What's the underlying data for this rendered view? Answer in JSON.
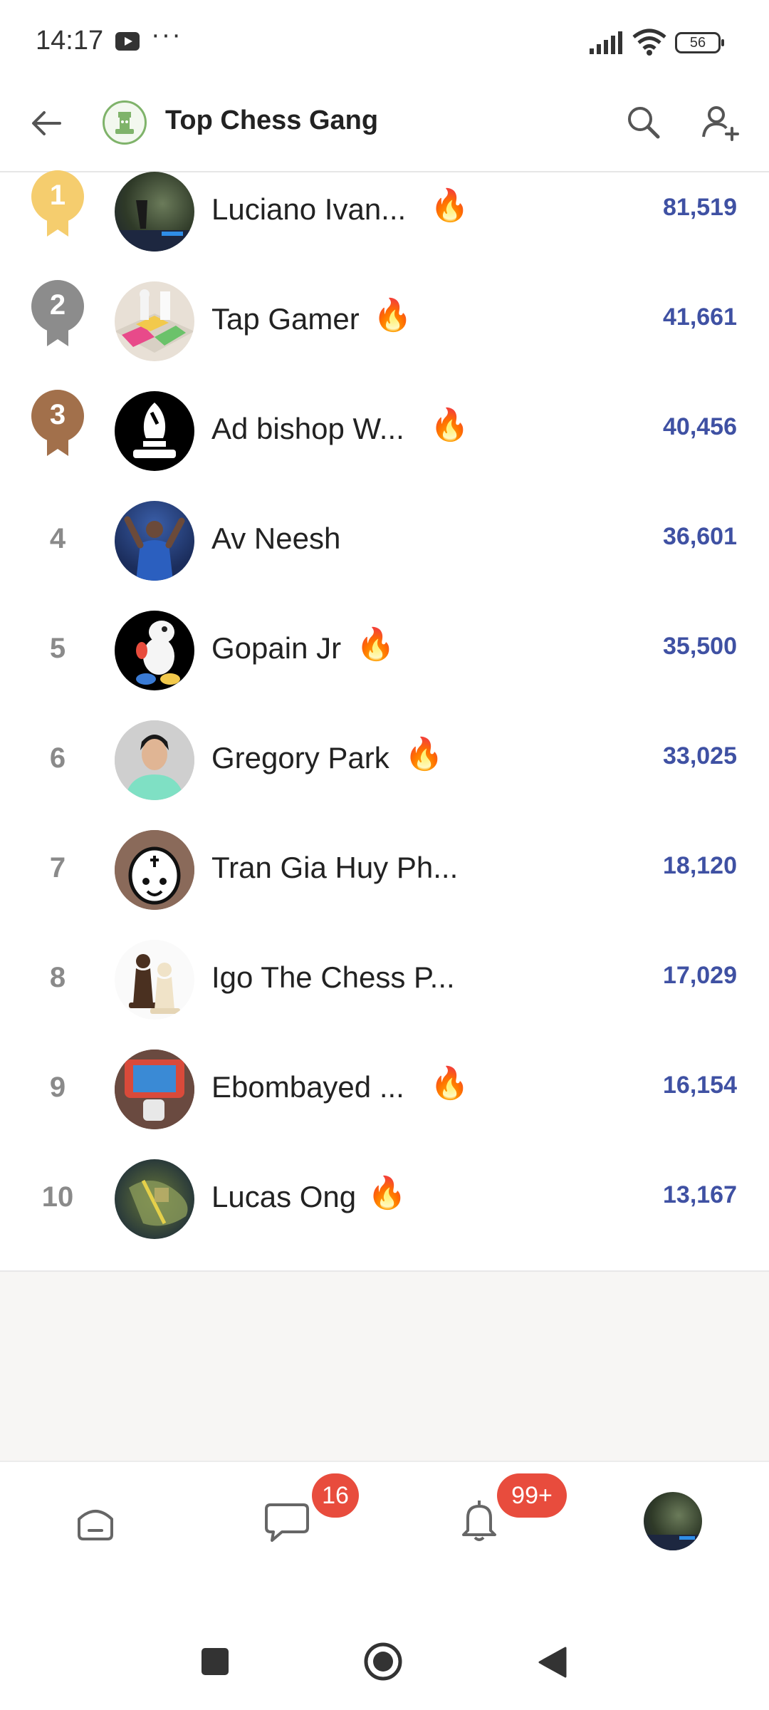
{
  "status_bar": {
    "time": "14:17",
    "battery": "56"
  },
  "header": {
    "title": "Top Chess Gang"
  },
  "leaderboard": [
    {
      "rank": "1",
      "name": "Luciano Ivan...",
      "score": "81,519",
      "fire": true,
      "medal": "gold"
    },
    {
      "rank": "2",
      "name": "Tap Gamer",
      "score": "41,661",
      "fire": true,
      "medal": "silver"
    },
    {
      "rank": "3",
      "name": "Ad bishop W...",
      "score": "40,456",
      "fire": true,
      "medal": "bronze"
    },
    {
      "rank": "4",
      "name": "Av Neesh",
      "score": "36,601",
      "fire": false
    },
    {
      "rank": "5",
      "name": "Gopain Jr",
      "score": "35,500",
      "fire": true
    },
    {
      "rank": "6",
      "name": "Gregory Park",
      "score": "33,025",
      "fire": true
    },
    {
      "rank": "7",
      "name": "Tran Gia Huy Ph...",
      "score": "18,120",
      "fire": false
    },
    {
      "rank": "8",
      "name": "Igo The Chess P...",
      "score": "17,029",
      "fire": false
    },
    {
      "rank": "9",
      "name": "Ebombayed ...",
      "score": "16,154",
      "fire": true
    },
    {
      "rank": "10",
      "name": "Lucas Ong",
      "score": "13,167",
      "fire": true
    }
  ],
  "bottom_nav": {
    "chat_badge": "16",
    "notif_badge": "99+",
    "icons": [
      "home-icon",
      "chat-icon",
      "bell-icon",
      "profile-avatar"
    ]
  },
  "colors": {
    "score": "#3f51a3",
    "badge": "#e84c3d",
    "gold": "#f5cd6e",
    "silver": "#8c8c8c",
    "bronze": "#a2704b"
  }
}
